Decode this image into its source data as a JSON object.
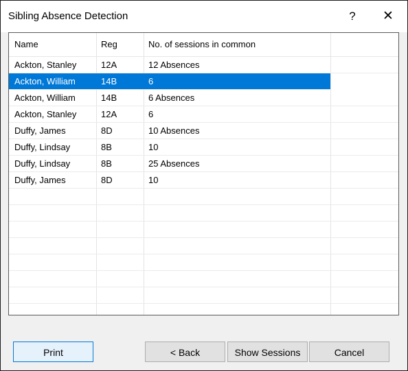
{
  "window": {
    "title": "Sibling Absence Detection",
    "help_glyph": "?",
    "close_glyph": "✕"
  },
  "table": {
    "columns": [
      "Name",
      "Reg",
      "No. of sessions in common"
    ],
    "selected_row": 1,
    "rows": [
      {
        "name": "Ackton, Stanley",
        "reg": "12A",
        "sessions": "12 Absences"
      },
      {
        "name": "Ackton, William",
        "reg": "14B",
        "sessions": "6"
      },
      {
        "name": "Ackton, William",
        "reg": "14B",
        "sessions": "6 Absences"
      },
      {
        "name": "Ackton, Stanley",
        "reg": "12A",
        "sessions": "6"
      },
      {
        "name": "Duffy, James",
        "reg": "8D",
        "sessions": "10 Absences"
      },
      {
        "name": "Duffy, Lindsay",
        "reg": "8B",
        "sessions": "10"
      },
      {
        "name": "Duffy, Lindsay",
        "reg": "8B",
        "sessions": "25 Absences"
      },
      {
        "name": "Duffy, James",
        "reg": "8D",
        "sessions": "10"
      }
    ]
  },
  "buttons": {
    "print": "Print",
    "back": "< Back",
    "show_sessions": "Show Sessions",
    "cancel": "Cancel"
  },
  "colors": {
    "selection": "#0078d7",
    "dialog_background": "#f0f0f0"
  }
}
